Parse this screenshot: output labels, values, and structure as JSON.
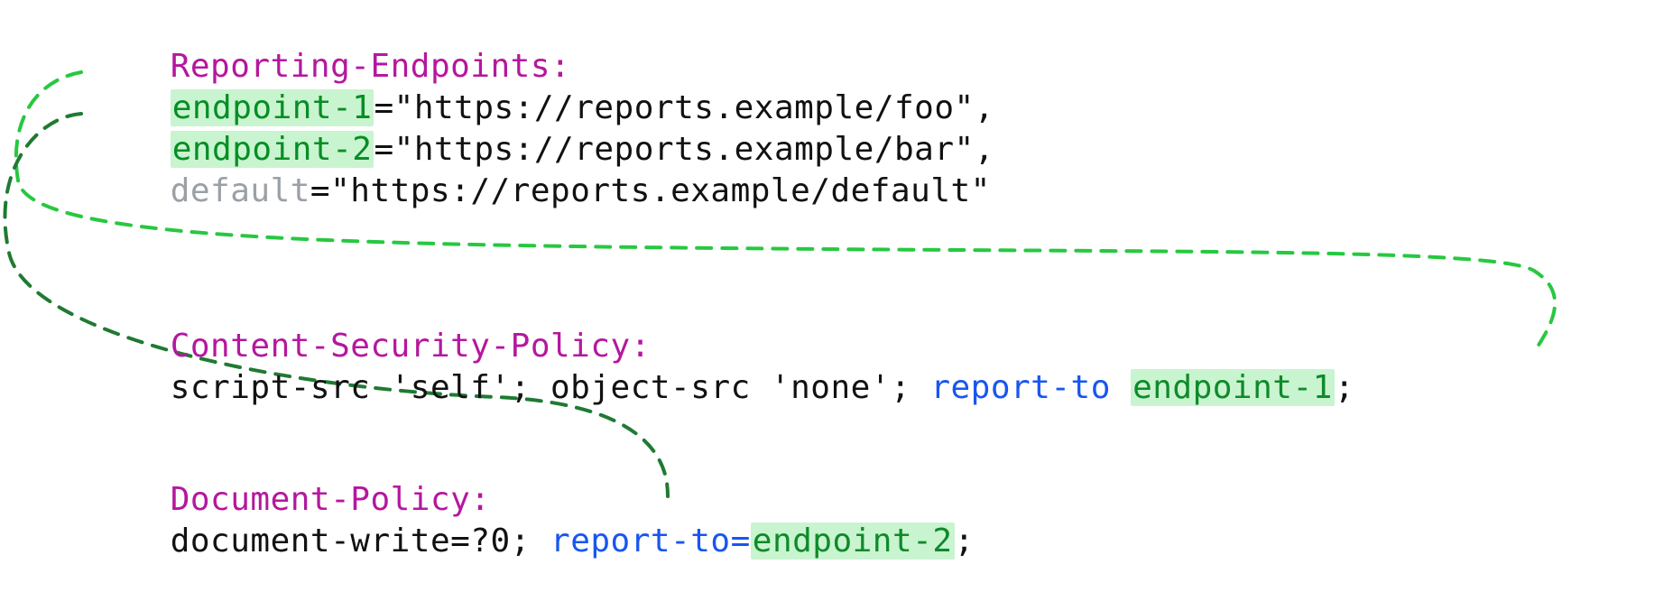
{
  "colors": {
    "header_name": "#b5179e",
    "endpoint_key_green": "#068e24",
    "endpoint_highlight_bg": "#c9f4d0",
    "endpoint_key_gray": "#9aa0a6",
    "report_to_blue": "#1856f0",
    "connector_light_green": "#27c840",
    "connector_dark_green": "#1f7a33",
    "text_black": "#111111"
  },
  "headers": {
    "reporting_endpoints": {
      "name": "Reporting-Endpoints:",
      "entries": [
        {
          "key": "endpoint-1",
          "key_style": "used",
          "url": "\"https://reports.example/foo\"",
          "suffix": ","
        },
        {
          "key": "endpoint-2",
          "key_style": "used",
          "url": "\"https://reports.example/bar\"",
          "suffix": ","
        },
        {
          "key": "default",
          "key_style": "default",
          "url": "\"https://reports.example/default\"",
          "suffix": ""
        }
      ]
    },
    "csp": {
      "name": "Content-Security-Policy:",
      "body_prefix": "script-src 'self'; object-src 'none'; ",
      "report_to_label": "report-to ",
      "report_to_target": "endpoint-1",
      "body_suffix": ";"
    },
    "doc_policy": {
      "name": "Document-Policy:",
      "body_prefix": "document-write=?0; ",
      "report_to_label": "report-to=",
      "report_to_target": "endpoint-2",
      "body_suffix": ";"
    }
  },
  "connectors": [
    {
      "from": "reporting_endpoints.entries.0",
      "to": "csp.report_to_target",
      "color": "connector_light_green"
    },
    {
      "from": "reporting_endpoints.entries.1",
      "to": "doc_policy.report_to_target",
      "color": "connector_dark_green"
    }
  ]
}
